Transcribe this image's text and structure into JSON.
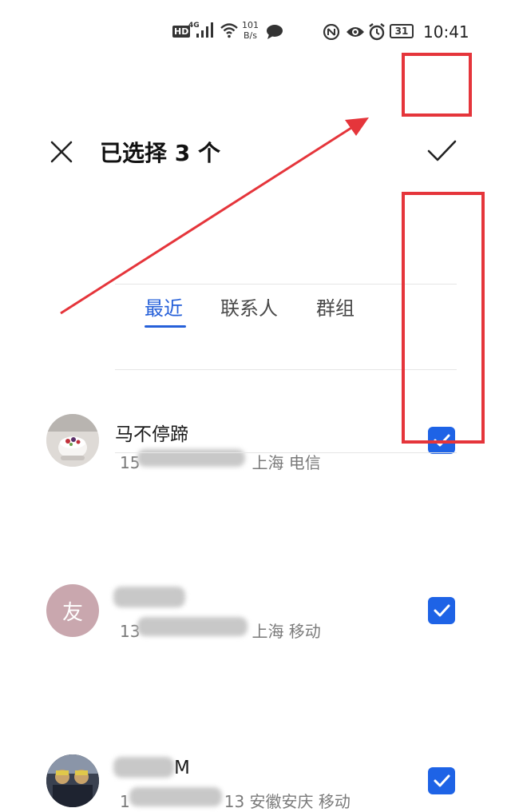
{
  "status_bar": {
    "hd": "HD",
    "network": "4G",
    "speed_value": "101",
    "speed_unit": "B/s",
    "battery": "31",
    "time": "10:41"
  },
  "header": {
    "title": "已选择 3 个"
  },
  "tabs": [
    {
      "label": "最近",
      "active": true
    },
    {
      "label": "联系人",
      "active": false
    },
    {
      "label": "群组",
      "active": false
    }
  ],
  "contacts": [
    {
      "name": "马不停蹄",
      "number_prefix": "15",
      "number_suffix": "",
      "location": "上海 电信",
      "checked": true
    },
    {
      "name": "",
      "number_prefix": "13",
      "number_suffix": "",
      "location": "上海 移动",
      "checked": true,
      "avatar_text": "友"
    },
    {
      "name": "M",
      "number_prefix": "1",
      "number_suffix": "13",
      "location": "安徽安庆 移动",
      "checked": true
    }
  ],
  "colors": {
    "accent": "#2660d9",
    "checkbox": "#1e63e6",
    "annotation": "#e5353b",
    "avatar_placeholder": "#c9a7ae"
  }
}
